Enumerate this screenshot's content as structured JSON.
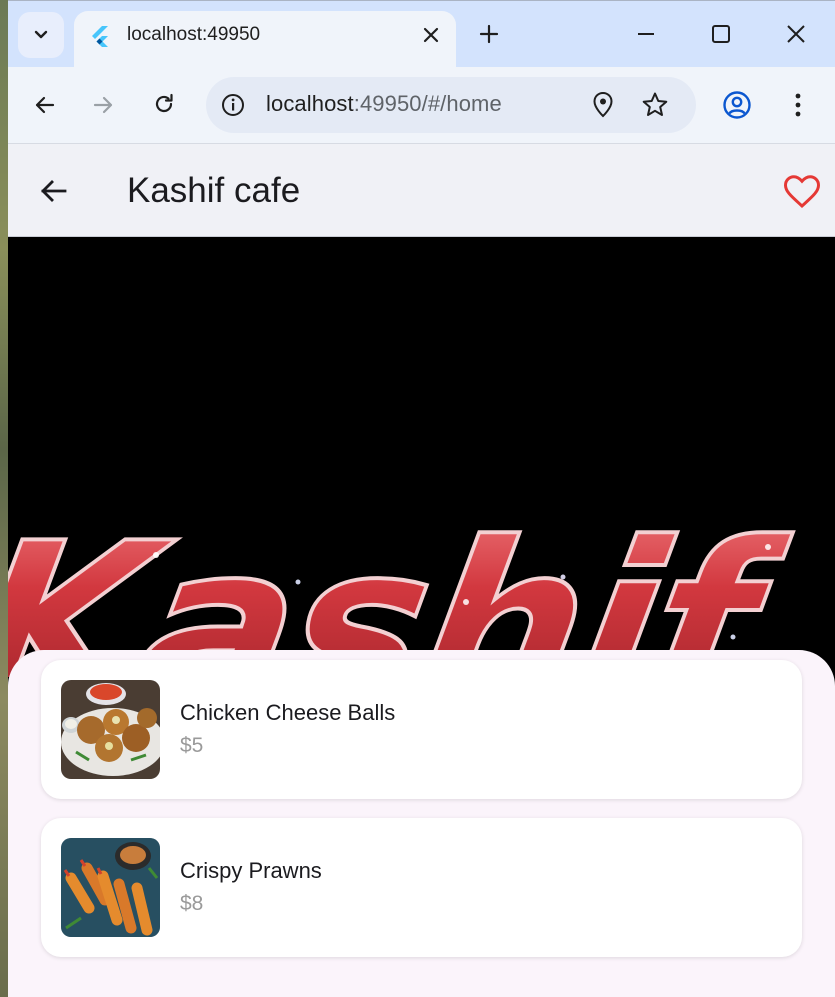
{
  "browser": {
    "tab_title": "localhost:49950",
    "url_host": "localhost",
    "url_rest": ":49950/#/home",
    "icons": {
      "tab_search": "chevron-down-icon",
      "favicon": "flutter-icon",
      "tab_close": "close-icon",
      "new_tab": "plus-icon",
      "minimize": "minimize-icon",
      "maximize": "maximize-icon",
      "close_window": "close-icon",
      "back": "arrow-left-icon",
      "forward": "arrow-right-icon",
      "reload": "reload-icon",
      "site_info": "info-icon",
      "location": "location-pin-icon",
      "bookmark": "star-icon",
      "profile": "account-circle-icon",
      "menu": "more-vert-icon"
    },
    "colors": {
      "tabstrip": "#d3e3fd",
      "toolbar": "#f0f4fa",
      "profile_accent": "#0b57d0"
    }
  },
  "app": {
    "title": "Kashif cafe",
    "banner_text": "Kashif",
    "icons": {
      "back": "arrow-back-icon",
      "favorite": "heart-outline-icon"
    },
    "colors": {
      "favorite": "#e53935",
      "banner_text": "#c8323a",
      "sheet": "#fbf4fb"
    },
    "menu_items": [
      {
        "name": "Chicken Cheese Balls",
        "price": "$5",
        "image": "chicken-cheese-balls-photo"
      },
      {
        "name": "Crispy Prawns",
        "price": "$8",
        "image": "crispy-prawns-photo"
      }
    ]
  }
}
